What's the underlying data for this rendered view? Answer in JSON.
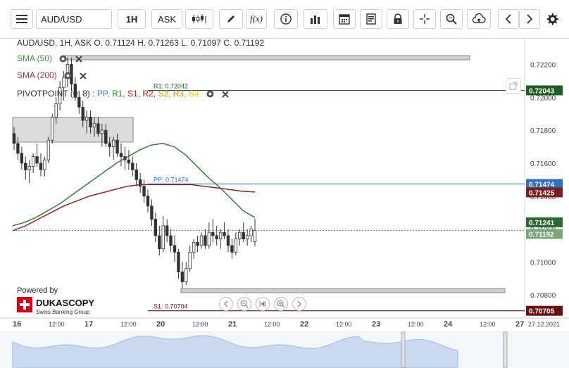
{
  "toolbar": {
    "symbol": "AUD/USD",
    "timeframe": "1H",
    "price_side": "ASK",
    "fx_label": "f(x)"
  },
  "legend": {
    "ohlc": "AUD/USD, 1H, ASK   O. 0.71124 H. 0.71263 L. 0.71097 C. 0.71192",
    "sma50": "SMA (50)",
    "sma200": "SMA (200)",
    "pivot_prefix": "PIVOTPOINT (0, 8)",
    "pivot_sep": " : ",
    "pivot_items": [
      {
        "text": "PP,",
        "color": "#3b7fd1"
      },
      {
        "text": "R1,",
        "color": "#2e7d32"
      },
      {
        "text": "S1,",
        "color": "#b71c1c"
      },
      {
        "text": "R2,",
        "color": "#b71c1c"
      },
      {
        "text": "S2,",
        "color": "#e08a00"
      },
      {
        "text": "R3,",
        "color": "#e08a00"
      },
      {
        "text": "S3",
        "color": "#e6c200"
      }
    ]
  },
  "levels": {
    "r1_label": "R1: 0.72042",
    "pp_label": "PP: 0.71474",
    "s1_label": "S1: 0.70704"
  },
  "price_axis": {
    "ticks": [
      "0.72200",
      "0.72000",
      "0.71800",
      "0.71600",
      "0.71400",
      "0.71200",
      "0.71000",
      "0.70800"
    ],
    "badges": [
      {
        "text": "0.72043",
        "color": "#1e5e1e"
      },
      {
        "text": "0.71474",
        "color": "#2f6fbf"
      },
      {
        "text": "0.71425",
        "color": "#7a2020"
      },
      {
        "text": "0.71241",
        "color": "#2d6a2d"
      },
      {
        "text": "0.71192",
        "color": "#7aa77a"
      },
      {
        "text": "0.70705",
        "color": "#6a1010"
      }
    ]
  },
  "time_axis": {
    "labels": [
      "16",
      "12:00",
      "17",
      "12:00",
      "20",
      "12:00",
      "21",
      "12:00",
      "22",
      "12:00",
      "23",
      "12:00",
      "24",
      "12:00",
      "27",
      "27.12.2021"
    ]
  },
  "branding": {
    "powered_by": "Powered by",
    "name": "DUKASCOPY",
    "tagline": "Swiss Banking Group"
  },
  "colors": {
    "sma50": "#3a7a3a",
    "sma200": "#8b2323",
    "bull": "#333333",
    "bear": "#333333"
  },
  "chart_data": {
    "type": "candlestick",
    "title": "AUD/USD, 1H, ASK",
    "ylim": [
      0.7066,
      0.7236
    ],
    "candles": [
      [
        0.7178,
        0.7182,
        0.7168,
        0.7172
      ],
      [
        0.7172,
        0.7176,
        0.7162,
        0.7166
      ],
      [
        0.7166,
        0.717,
        0.7156,
        0.716
      ],
      [
        0.716,
        0.7164,
        0.715,
        0.7156
      ],
      [
        0.7156,
        0.7162,
        0.7148,
        0.7158
      ],
      [
        0.7158,
        0.7166,
        0.7154,
        0.7164
      ],
      [
        0.7164,
        0.7172,
        0.7158,
        0.716
      ],
      [
        0.716,
        0.7166,
        0.7152,
        0.7156
      ],
      [
        0.7156,
        0.7164,
        0.7152,
        0.7162
      ],
      [
        0.7162,
        0.7176,
        0.716,
        0.7174
      ],
      [
        0.7174,
        0.719,
        0.7172,
        0.7188
      ],
      [
        0.7188,
        0.72,
        0.7184,
        0.7196
      ],
      [
        0.7196,
        0.721,
        0.7192,
        0.7206
      ],
      [
        0.7206,
        0.7216,
        0.7198,
        0.7212
      ],
      [
        0.7212,
        0.7224,
        0.7206,
        0.722
      ],
      [
        0.722,
        0.7224,
        0.7204,
        0.7208
      ],
      [
        0.7208,
        0.7212,
        0.7198,
        0.72
      ],
      [
        0.72,
        0.7204,
        0.719,
        0.7194
      ],
      [
        0.7194,
        0.7198,
        0.7182,
        0.7186
      ],
      [
        0.7186,
        0.7192,
        0.7178,
        0.7188
      ],
      [
        0.7188,
        0.7192,
        0.7178,
        0.7182
      ],
      [
        0.7182,
        0.7188,
        0.7176,
        0.7184
      ],
      [
        0.7184,
        0.7188,
        0.7176,
        0.7178
      ],
      [
        0.7178,
        0.7184,
        0.717,
        0.718
      ],
      [
        0.718,
        0.7184,
        0.717,
        0.7172
      ],
      [
        0.7172,
        0.7176,
        0.7164,
        0.717
      ],
      [
        0.717,
        0.7176,
        0.7162,
        0.7174
      ],
      [
        0.7174,
        0.7178,
        0.7164,
        0.7166
      ],
      [
        0.7166,
        0.7172,
        0.7158,
        0.7164
      ],
      [
        0.7164,
        0.717,
        0.7156,
        0.7162
      ],
      [
        0.7162,
        0.7168,
        0.7156,
        0.716
      ],
      [
        0.716,
        0.7164,
        0.7152,
        0.7156
      ],
      [
        0.7156,
        0.716,
        0.7146,
        0.715
      ],
      [
        0.715,
        0.7154,
        0.7142,
        0.7146
      ],
      [
        0.7146,
        0.715,
        0.7136,
        0.714
      ],
      [
        0.714,
        0.7144,
        0.713,
        0.7134
      ],
      [
        0.7134,
        0.7138,
        0.7122,
        0.7126
      ],
      [
        0.7126,
        0.713,
        0.7112,
        0.7116
      ],
      [
        0.7116,
        0.7122,
        0.7104,
        0.7108
      ],
      [
        0.7108,
        0.7128,
        0.7106,
        0.7122
      ],
      [
        0.7122,
        0.7126,
        0.7112,
        0.7116
      ],
      [
        0.7116,
        0.712,
        0.7106,
        0.711
      ],
      [
        0.711,
        0.7116,
        0.71,
        0.7106
      ],
      [
        0.7106,
        0.7108,
        0.709,
        0.7094
      ],
      [
        0.7094,
        0.71,
        0.7084,
        0.7088
      ],
      [
        0.7088,
        0.71,
        0.7086,
        0.7096
      ],
      [
        0.7096,
        0.711,
        0.7094,
        0.7106
      ],
      [
        0.7106,
        0.7114,
        0.7102,
        0.7112
      ],
      [
        0.7112,
        0.7116,
        0.7106,
        0.711
      ],
      [
        0.711,
        0.7118,
        0.7108,
        0.7116
      ],
      [
        0.7116,
        0.712,
        0.7108,
        0.711
      ],
      [
        0.711,
        0.7124,
        0.7108,
        0.7118
      ],
      [
        0.7118,
        0.7126,
        0.7112,
        0.7116
      ],
      [
        0.7116,
        0.7122,
        0.711,
        0.7114
      ],
      [
        0.7114,
        0.712,
        0.7108,
        0.7118
      ],
      [
        0.7118,
        0.7124,
        0.7114,
        0.7116
      ],
      [
        0.7116,
        0.712,
        0.7106,
        0.711
      ],
      [
        0.711,
        0.7114,
        0.7102,
        0.7106
      ],
      [
        0.7106,
        0.7118,
        0.7104,
        0.7114
      ],
      [
        0.7114,
        0.712,
        0.711,
        0.7118
      ],
      [
        0.7118,
        0.7124,
        0.7112,
        0.7114
      ],
      [
        0.7114,
        0.712,
        0.711,
        0.7116
      ],
      [
        0.7116,
        0.7122,
        0.7112,
        0.712
      ],
      [
        0.71124,
        0.71263,
        0.71097,
        0.71192
      ]
    ],
    "sma50": [
      0.7122,
      0.7124,
      0.7127,
      0.7131,
      0.7135,
      0.714,
      0.7145,
      0.715,
      0.7155,
      0.716,
      0.7164,
      0.7168,
      0.7171,
      0.7172,
      0.717,
      0.7165,
      0.7158,
      0.7151,
      0.7145,
      0.7138,
      0.7131,
      0.7127
    ],
    "sma200": [
      0.7119,
      0.7122,
      0.7126,
      0.713,
      0.7134,
      0.7137,
      0.714,
      0.7142,
      0.7144,
      0.7146,
      0.7147,
      0.7147,
      0.7147,
      0.7147,
      0.7147,
      0.7146,
      0.7145,
      0.7144,
      0.7143,
      0.71425
    ],
    "levels": {
      "R1": 0.72042,
      "PP": 0.71474,
      "S1": 0.70704
    }
  }
}
